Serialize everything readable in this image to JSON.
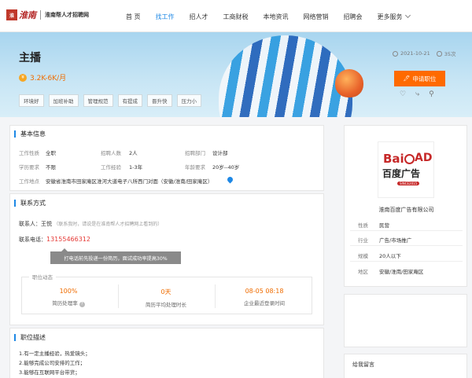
{
  "header": {
    "logo_seal": "淮",
    "logo_brand": "淮南",
    "logo_sub": "淮南帮人才招聘网",
    "nav": [
      {
        "label": "首 页",
        "active": false
      },
      {
        "label": "找工作",
        "active": true
      },
      {
        "label": "招人才",
        "active": false
      },
      {
        "label": "工商财税",
        "active": false
      },
      {
        "label": "本地资讯",
        "active": false
      },
      {
        "label": "网络营销",
        "active": false
      },
      {
        "label": "招聘会",
        "active": false
      },
      {
        "label": "更多服务",
        "active": false
      }
    ]
  },
  "job": {
    "title": "主播",
    "salary": "3.2K-6K/月",
    "salary_icon": "¥",
    "tags": [
      "环境好",
      "加班补助",
      "管理规范",
      "有提成",
      "晋升快",
      "压力小"
    ],
    "date": "2021-10-21",
    "views": "35次",
    "apply_label": "申请职位",
    "apply_icon": "🖊",
    "actions": [
      "♡",
      "⤷",
      "⚲"
    ]
  },
  "basic": {
    "section_title": "基本信息",
    "fields": [
      {
        "label": "工作性质",
        "value": "全职"
      },
      {
        "label": "招聘人数",
        "value": "2人"
      },
      {
        "label": "招聘部门",
        "value": "设计部"
      },
      {
        "label": "学历要求",
        "value": "不限"
      },
      {
        "label": "工作经验",
        "value": "1-3年"
      },
      {
        "label": "年龄要求",
        "value": "20岁--40岁"
      }
    ],
    "address_label": "工作地点",
    "address": "安徽省淮南市田家庵区淮河大道电子八所西门对面（安徽/淮南/田家庵区）"
  },
  "contact": {
    "section_title": "联系方式",
    "person_label": "联系人：",
    "person": "王悦",
    "note": "（联系我时，请说是在淮南帮人才招聘网上看到的）",
    "phone_label": "联系电话：",
    "phone": "13155466312",
    "tooltip": "打电话前先投递一份简历，面试成功率提高30%"
  },
  "dynamics": {
    "label": "职位动态",
    "stats": [
      {
        "num": "100%",
        "cap": "简历处理率"
      },
      {
        "num": "0天",
        "cap": "简历平均处理时长"
      },
      {
        "num": "08-05 08:18",
        "cap": "企业最近登录时间"
      }
    ],
    "help_icon": "?"
  },
  "description": {
    "section_title": "职位描述",
    "lines": [
      "1.有一定主播经验，热爱镜头；",
      "2.能够完成公司安排的工作；",
      "3.能够在互联网平台带货；"
    ]
  },
  "company": {
    "logo_bai": "Bai",
    "logo_ad": "AD",
    "logo_cn": "百度广告",
    "logo_small": "SINCE2015",
    "name": "淮南百度广告有限公司",
    "rows": [
      {
        "label": "性质",
        "value": "民营"
      },
      {
        "label": "行业",
        "value": "广告/市场推广"
      },
      {
        "label": "规模",
        "value": "20人以下"
      },
      {
        "label": "地区",
        "value": "安徽/淮南/田家庵区"
      }
    ]
  },
  "sidebar": {
    "message_title": "给我留言"
  }
}
